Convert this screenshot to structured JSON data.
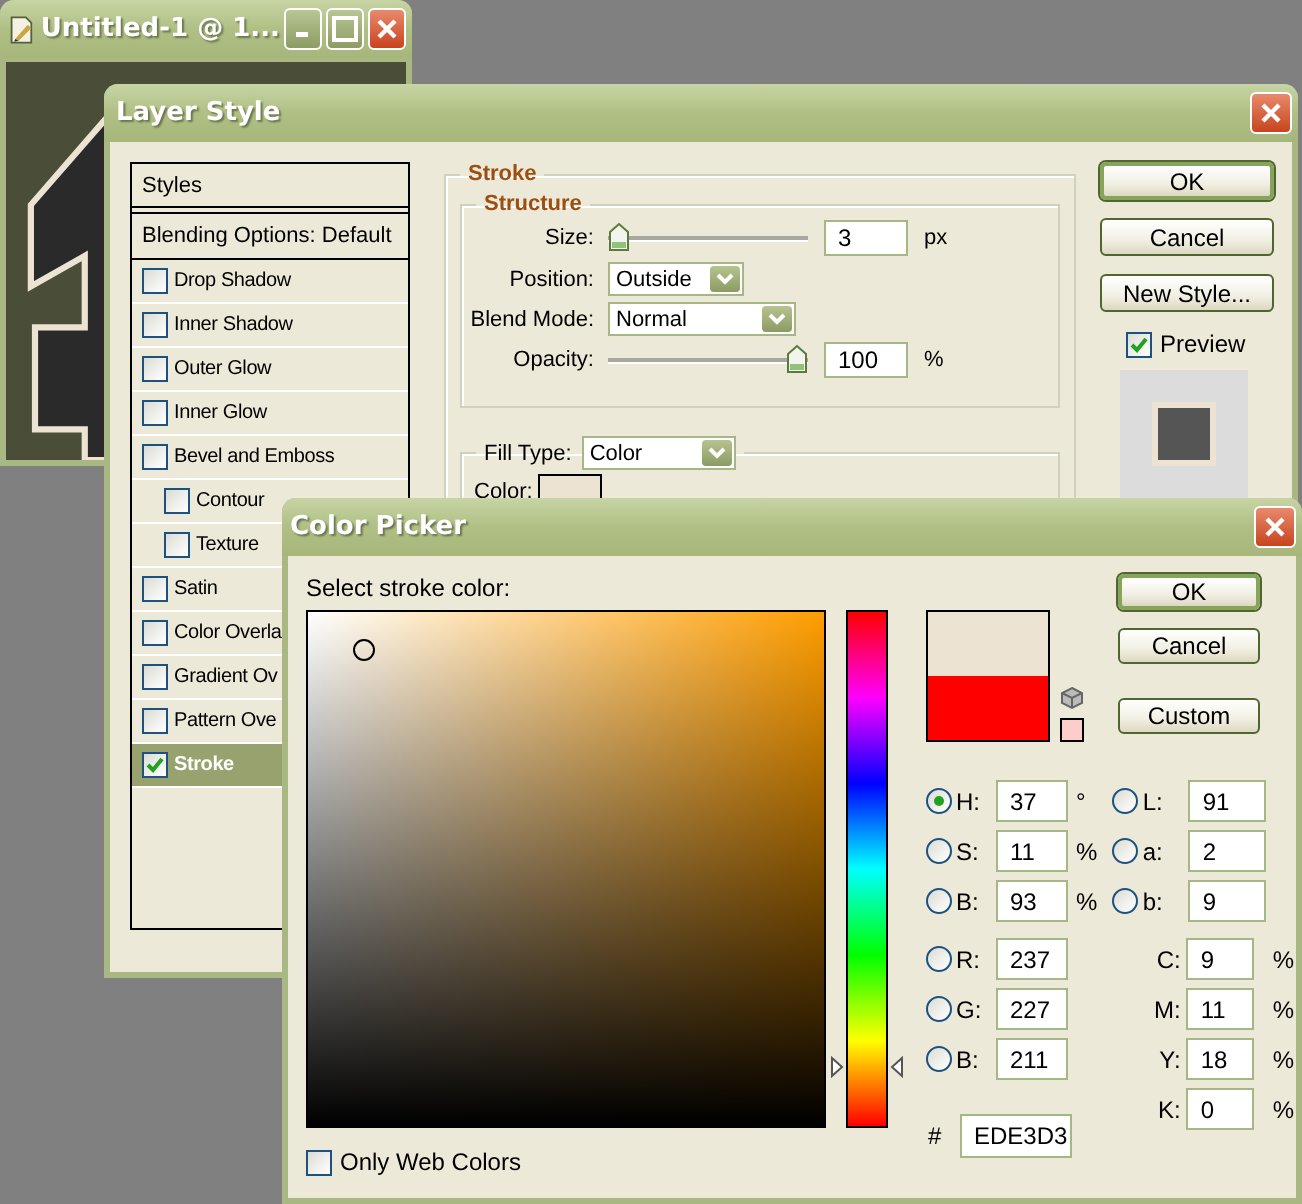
{
  "document_window": {
    "title": "Untitled-1 @ 1..."
  },
  "layer_style": {
    "title": "Layer Style",
    "styles_header": "Styles",
    "blending_options": "Blending Options: Default",
    "effects": [
      {
        "label": "Drop Shadow",
        "checked": false,
        "selected": false
      },
      {
        "label": "Inner Shadow",
        "checked": false,
        "selected": false
      },
      {
        "label": "Outer Glow",
        "checked": false,
        "selected": false
      },
      {
        "label": "Inner Glow",
        "checked": false,
        "selected": false
      },
      {
        "label": "Bevel and Emboss",
        "checked": false,
        "selected": false,
        "children": [
          {
            "label": "Contour",
            "checked": false,
            "selected": false
          },
          {
            "label": "Texture",
            "checked": false,
            "selected": false
          }
        ]
      },
      {
        "label": "Satin",
        "checked": false,
        "selected": false
      },
      {
        "label": "Color Overla",
        "checked": false,
        "selected": false
      },
      {
        "label": "Gradient Ov",
        "checked": false,
        "selected": false
      },
      {
        "label": "Pattern Ove",
        "checked": false,
        "selected": false
      },
      {
        "label": "Stroke",
        "checked": true,
        "selected": true
      }
    ],
    "stroke": {
      "title": "Stroke",
      "structure": {
        "title": "Structure",
        "size": {
          "label": "Size:",
          "level": 0.0,
          "value": "3",
          "unit": "px"
        },
        "position": {
          "label": "Position:",
          "value": "Outside"
        },
        "blend_mode": {
          "label": "Blend Mode:",
          "value": "Normal"
        },
        "opacity": {
          "label": "Opacity:",
          "level": 1.0,
          "value": "100",
          "unit": "%"
        }
      },
      "fill_type": {
        "label": "Fill Type:",
        "value": "Color"
      },
      "color": {
        "label": "Color:",
        "color": "#ede3d3"
      }
    },
    "buttons": [
      {
        "label": "OK",
        "default": true
      },
      {
        "label": "Cancel",
        "default": false
      },
      {
        "label": "New Style...",
        "default": false
      }
    ],
    "preview": {
      "label": "Preview",
      "checked": true
    }
  },
  "color_picker": {
    "title": "Color Picker",
    "prompt": "Select stroke color:",
    "buttons": [
      {
        "label": "OK",
        "default": true
      },
      {
        "label": "Cancel",
        "default": false
      },
      {
        "label": "Custom",
        "default": false
      }
    ],
    "color_preview": [
      {
        "color": "#ede3d3"
      },
      {
        "color": "#ff0000"
      }
    ],
    "web_safe_swatch": {
      "color": "#ffcccc"
    },
    "hue_slider": {
      "level": 0.1
    },
    "hsb": [
      {
        "label": "H:",
        "value": "37",
        "unit": "°",
        "selected": true
      },
      {
        "label": "S:",
        "value": "11",
        "unit": "%",
        "selected": false
      },
      {
        "label": "B:",
        "value": "93",
        "unit": "%",
        "selected": false
      }
    ],
    "lab": [
      {
        "label": "L:",
        "value": "91",
        "selected": false
      },
      {
        "label": "a:",
        "value": "2",
        "selected": false
      },
      {
        "label": "b:",
        "value": "9",
        "selected": false
      }
    ],
    "rgb": [
      {
        "label": "R:",
        "value": "237",
        "selected": false
      },
      {
        "label": "G:",
        "value": "227",
        "selected": false
      },
      {
        "label": "B:",
        "value": "211",
        "selected": false
      }
    ],
    "cmyk": [
      {
        "label": "C:",
        "value": "9",
        "unit": "%"
      },
      {
        "label": "M:",
        "value": "11",
        "unit": "%"
      },
      {
        "label": "Y:",
        "value": "18",
        "unit": "%"
      },
      {
        "label": "K:",
        "value": "0",
        "unit": "%"
      }
    ],
    "hex": {
      "label": "#",
      "value": "EDE3D3"
    },
    "web_only": {
      "label": "Only Web Colors",
      "checked": false
    }
  }
}
